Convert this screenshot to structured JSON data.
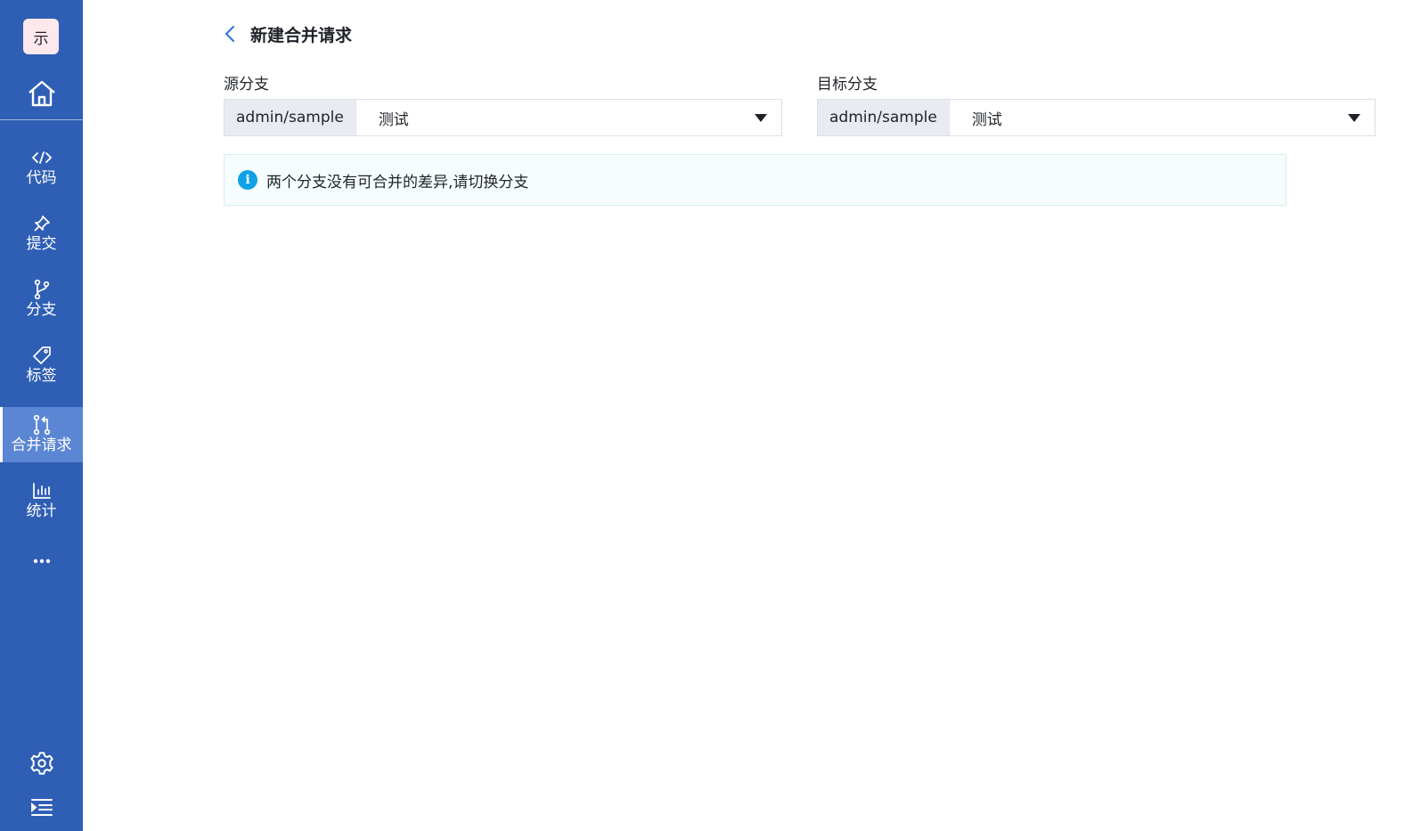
{
  "sidebar": {
    "logo_text": "示",
    "items": [
      {
        "label": "代码",
        "icon": "code-icon"
      },
      {
        "label": "提交",
        "icon": "pin-icon"
      },
      {
        "label": "分支",
        "icon": "branch-icon"
      },
      {
        "label": "标签",
        "icon": "tag-icon"
      },
      {
        "label": "合并请求",
        "icon": "merge-request-icon",
        "active": true
      },
      {
        "label": "统计",
        "icon": "bar-chart-icon"
      }
    ]
  },
  "header": {
    "title": "新建合并请求"
  },
  "source_branch": {
    "label": "源分支",
    "repo": "admin/sample",
    "value": "测试"
  },
  "target_branch": {
    "label": "目标分支",
    "repo": "admin/sample",
    "value": "测试"
  },
  "notice": {
    "text": "两个分支没有可合并的差异,请切换分支"
  },
  "colors": {
    "sidebar_bg": "#2f5fb5",
    "sidebar_active": "#5b86d3",
    "accent": "#2f6fdc",
    "info": "#0fa0e6"
  }
}
